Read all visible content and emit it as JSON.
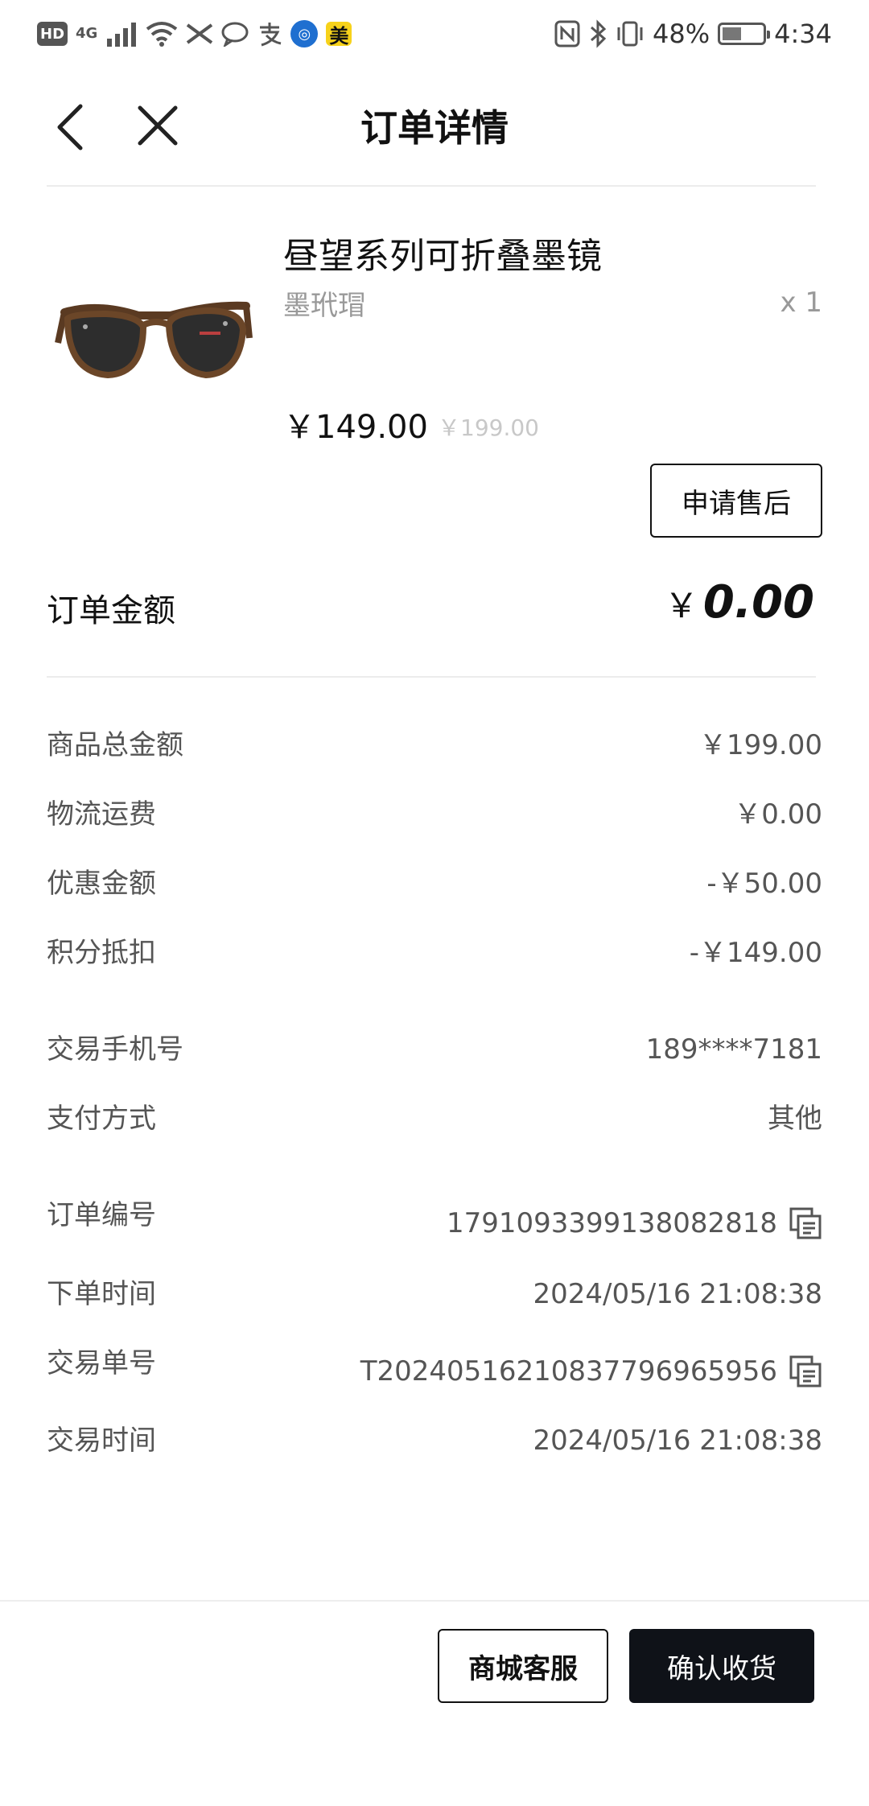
{
  "status_bar": {
    "left_icons": [
      "HD",
      "4G",
      "signal-icon",
      "wifi-icon",
      "vpn-icon",
      "chat-icon",
      "alipay-icon",
      "bank-icon",
      "美"
    ],
    "battery_percent": "48%",
    "battery_level": 0.48,
    "time": "4:34"
  },
  "header": {
    "title": "订单详情"
  },
  "product": {
    "name": "昼望系列可折叠墨镜",
    "spec": "墨玳瑁",
    "quantity": "x 1",
    "price": "￥149.00",
    "original_price": "￥199.00",
    "after_sale_label": "申请售后"
  },
  "order_amount": {
    "label": "订单金额",
    "currency": "￥",
    "value": "0.00"
  },
  "details": {
    "goods_total_label": "商品总金额",
    "goods_total_value": "￥199.00",
    "shipping_label": "物流运费",
    "shipping_value": "￥0.00",
    "discount_label": "优惠金额",
    "discount_value": "-￥50.00",
    "points_label": "积分抵扣",
    "points_value": "-￥149.00",
    "phone_label": "交易手机号",
    "phone_value": "189****7181",
    "payment_label": "支付方式",
    "payment_value": "其他",
    "order_no_label": "订单编号",
    "order_no_value": "1791093399138082818",
    "order_time_label": "下单时间",
    "order_time_value": "2024/05/16 21:08:38",
    "trade_no_label": "交易单号",
    "trade_no_value": "T20240516210837796965956",
    "trade_time_label": "交易时间",
    "trade_time_value": "2024/05/16 21:08:38"
  },
  "footer": {
    "service_label": "商城客服",
    "confirm_label": "确认收货"
  },
  "colors": {
    "primary_dark": "#0f1218",
    "muted_text": "#555555",
    "light_text": "#999999",
    "divider": "#ececec"
  }
}
